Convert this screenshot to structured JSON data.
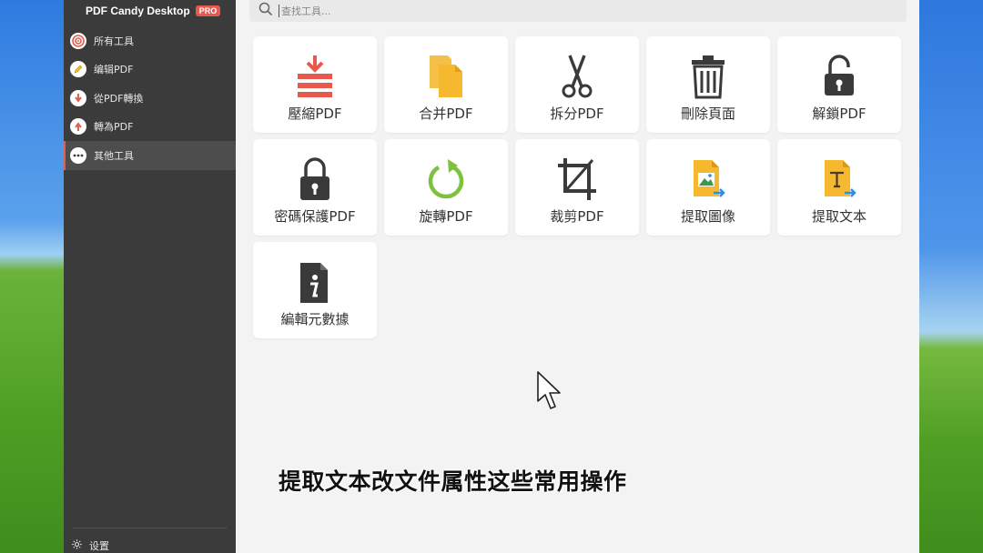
{
  "app": {
    "title": "PDF Candy Desktop",
    "badge": "PRO"
  },
  "sidebar": {
    "items": [
      {
        "label": "所有工具",
        "icon": "target-icon"
      },
      {
        "label": "编辑PDF",
        "icon": "pencil-icon"
      },
      {
        "label": "從PDF轉換",
        "icon": "arrow-down-icon"
      },
      {
        "label": "轉為PDF",
        "icon": "arrow-up-icon"
      },
      {
        "label": "其他工具",
        "icon": "more-dots-icon"
      }
    ],
    "active_index": 4,
    "settings_label": "设置"
  },
  "search": {
    "placeholder": "查找工具..."
  },
  "tools": [
    {
      "label": "壓縮PDF",
      "icon": "compress-icon"
    },
    {
      "label": "合并PDF",
      "icon": "merge-icon"
    },
    {
      "label": "拆分PDF",
      "icon": "scissors-icon"
    },
    {
      "label": "刪除頁面",
      "icon": "trash-icon"
    },
    {
      "label": "解鎖PDF",
      "icon": "unlock-icon"
    },
    {
      "label": "密碼保護PDF",
      "icon": "lock-icon"
    },
    {
      "label": "旋轉PDF",
      "icon": "rotate-icon"
    },
    {
      "label": "裁剪PDF",
      "icon": "crop-icon"
    },
    {
      "label": "提取圖像",
      "icon": "extract-image-icon"
    },
    {
      "label": "提取文本",
      "icon": "extract-text-icon"
    },
    {
      "label": "編輯元數據",
      "icon": "info-icon"
    }
  ],
  "caption": "提取文本改文件属性这些常用操作",
  "colors": {
    "accent": "#e05d50",
    "sidebar_bg": "#3b3b3b",
    "yellow": "#f5b82e",
    "green": "#7dc13f",
    "dark_icon": "#3a3a3a",
    "blue_arrow": "#2f8fe0"
  }
}
